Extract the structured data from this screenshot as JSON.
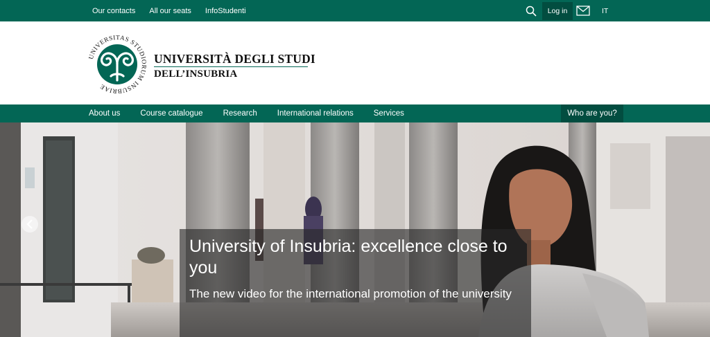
{
  "topbar": {
    "links": [
      "Our contacts",
      "All our seats",
      "InfoStudenti"
    ],
    "login_label": "Log in",
    "language": "IT",
    "search_icon": "search-icon",
    "mail_icon": "mail-icon"
  },
  "header": {
    "logo_ring_text": "UNIVERSITAS STUDIORUM INSUBRIAE",
    "name_line1": "UNIVERSITÀ DEGLI STUDI",
    "name_line2": "DELL’INSUBRIA"
  },
  "mainnav": {
    "items": [
      "About us",
      "Course catalogue",
      "Research",
      "International relations",
      "Services"
    ],
    "who_label": "Who are you?"
  },
  "hero": {
    "title": "University of Insubria: excellence close to you",
    "subtitle": "The new video for the international promotion of the university",
    "prev_icon": "chevron-left-icon"
  },
  "colors": {
    "brand_green": "#036655",
    "brand_green_dark": "#024d40"
  }
}
